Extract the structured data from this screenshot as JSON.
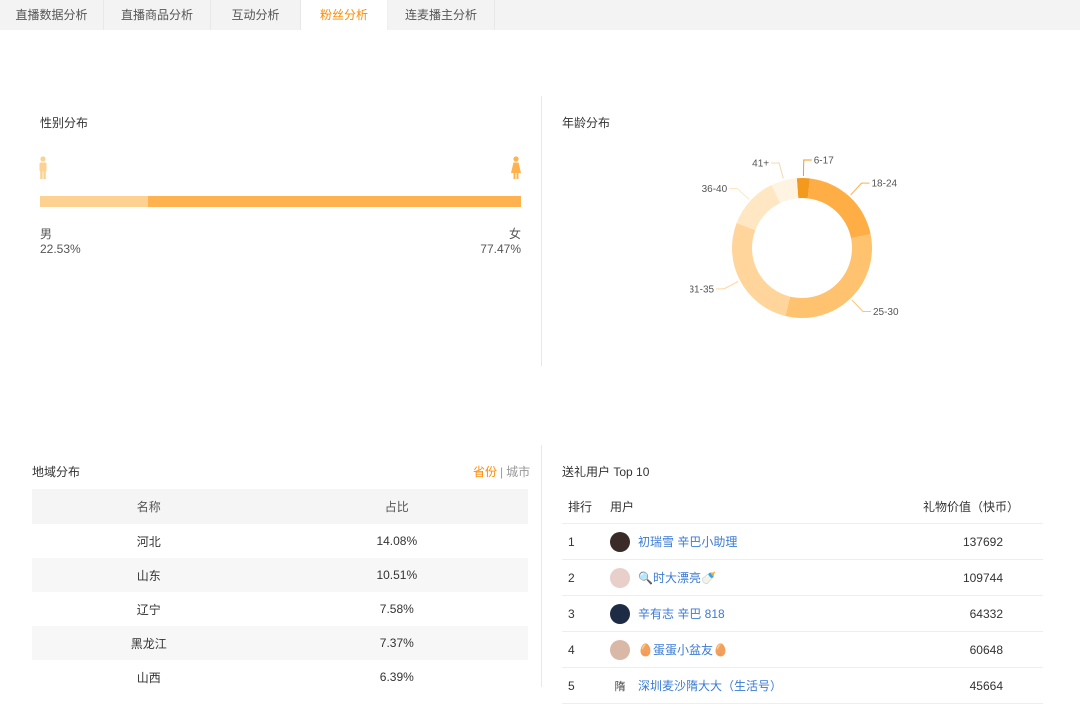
{
  "tabs": [
    {
      "label": "直播数据分析",
      "active": false
    },
    {
      "label": "直播商品分析",
      "active": false
    },
    {
      "label": "互动分析",
      "active": false
    },
    {
      "label": "粉丝分析",
      "active": true
    },
    {
      "label": "连麦播主分析",
      "active": false
    }
  ],
  "gender": {
    "title": "性别分布",
    "male": {
      "label": "男",
      "percent_text": "22.53%",
      "value": 22.53,
      "color": "#fdd18f"
    },
    "female": {
      "label": "女",
      "percent_text": "77.47%",
      "value": 77.47,
      "color": "#ffb24e"
    }
  },
  "age": {
    "title": "年龄分布",
    "chart_data": {
      "type": "pie",
      "donut": true,
      "labels": [
        "6-17",
        "18-24",
        "25-30",
        "31-35",
        "36-40",
        "41+"
      ],
      "values": [
        3,
        20,
        32,
        27,
        12,
        6
      ],
      "colors": [
        "#f39a1e",
        "#ffad45",
        "#ffc370",
        "#ffd59c",
        "#ffe7c4",
        "#fff3e2"
      ]
    }
  },
  "region": {
    "title": "地域分布",
    "toggle": {
      "province": "省份",
      "separator": "|",
      "city": "城市"
    },
    "columns": [
      "名称",
      "占比"
    ],
    "rows": [
      {
        "name": "河北",
        "pct": "14.08%"
      },
      {
        "name": "山东",
        "pct": "10.51%"
      },
      {
        "name": "辽宁",
        "pct": "7.58%"
      },
      {
        "name": "黑龙江",
        "pct": "7.37%"
      },
      {
        "name": "山西",
        "pct": "6.39%"
      }
    ]
  },
  "gifts": {
    "title": "送礼用户 Top 10",
    "columns": [
      "排行",
      "用户",
      "礼物价值（快币）"
    ],
    "rows": [
      {
        "rank": "1",
        "name": "初瑞雪 辛巴小助理",
        "value": "137692",
        "avatar_color": "#3a2a28"
      },
      {
        "rank": "2",
        "name": "🔍时大漂亮🍼",
        "value": "109744",
        "avatar_color": "#e8cfc9"
      },
      {
        "rank": "3",
        "name": "辛有志 辛巴 818",
        "value": "64332",
        "avatar_color": "#1d2b45"
      },
      {
        "rank": "4",
        "name": "🥚蛋蛋小盆友🥚",
        "value": "60648",
        "avatar_color": "#d9b8a8"
      },
      {
        "rank": "5",
        "name": "深圳麦沙隋大大（生活号）",
        "value": "45664",
        "avatar_color": "#ffffff",
        "avatar_text": "隋"
      }
    ]
  }
}
